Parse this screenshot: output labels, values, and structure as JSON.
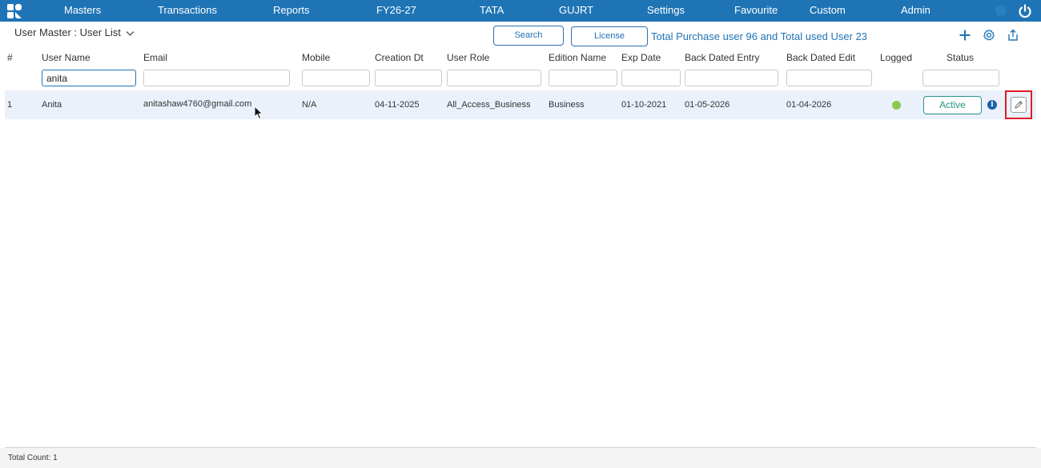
{
  "nav": {
    "items": [
      "Masters",
      "Transactions",
      "Reports",
      "FY26-27",
      "TATA",
      "GUJRT",
      "Settings",
      "Favourite",
      "Custom",
      "Admin"
    ]
  },
  "toolbar": {
    "title": "User Master : User List",
    "search_label": "Search",
    "license_label": "License",
    "license_info": "Total Purchase user 96 and Total used User 23"
  },
  "table": {
    "columns": [
      "#",
      "User Name",
      "Email",
      "Mobile",
      "Creation Dt",
      "User Role",
      "Edition Name",
      "Exp Date",
      "Back Dated Entry",
      "Back Dated Edit",
      "Logged",
      "Status"
    ],
    "filters": {
      "user_name": "anita"
    },
    "rows": [
      {
        "index": "1",
        "user_name": "Anita",
        "email": "anitashaw4760@gmail.com",
        "mobile": "N/A",
        "creation_dt": "04-11-2025",
        "user_role": "All_Access_Business",
        "edition_name": "Business",
        "exp_date": "01-10-2021",
        "back_dated_entry": "01-05-2026",
        "back_dated_edit": "01-04-2026",
        "logged": "online",
        "status": "Active"
      }
    ]
  },
  "footer": {
    "total_count": "Total Count: 1"
  },
  "colors": {
    "nav_bg": "#1f74b5",
    "accent": "#1f74b5",
    "status_teal": "#2a8f86",
    "logged_dot": "#8cc84b",
    "highlight": "#e01b24",
    "row_bg": "#eaf1fa"
  },
  "icons": {
    "logo": "app-logo-icon",
    "power": "power-icon",
    "add": "plus-icon",
    "settings": "gear-icon",
    "export": "share-export-icon",
    "info": "info-icon",
    "edit": "pencil-edit-icon"
  }
}
